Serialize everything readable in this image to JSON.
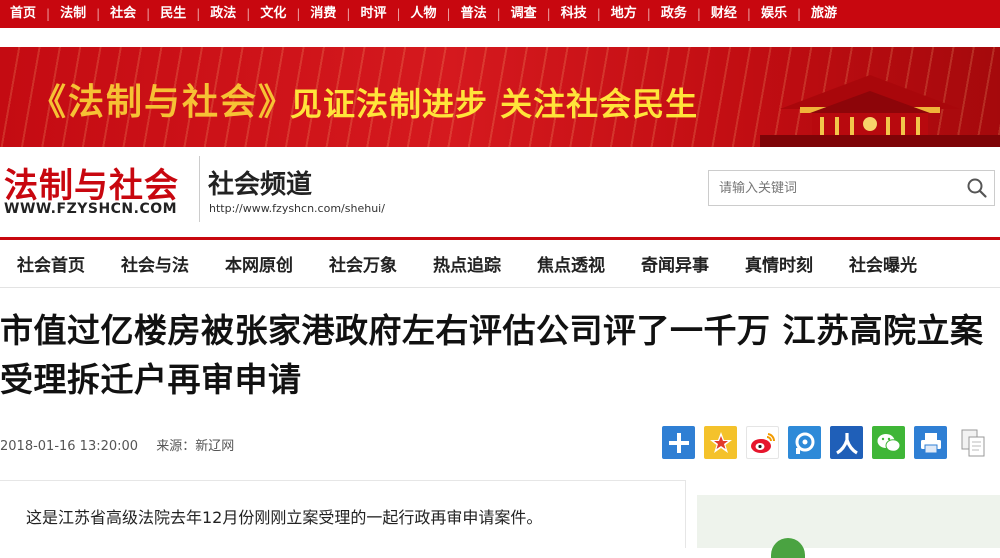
{
  "topnav": {
    "items": [
      "首页",
      "法制",
      "社会",
      "民生",
      "政法",
      "文化",
      "消费",
      "时评",
      "人物",
      "普法",
      "调查",
      "科技",
      "地方",
      "政务",
      "财经",
      "娱乐",
      "旅游"
    ],
    "separator": "|"
  },
  "banner": {
    "brand": "《法制与社会》",
    "slogan": "见证法制进步 关注社会民生"
  },
  "header": {
    "logo_title": "法制与社会",
    "logo_url": "WWW.FZYSHCN.COM",
    "channel_title": "社会频道",
    "channel_url": "http://www.fzyshcn.com/shehui/"
  },
  "search": {
    "placeholder": "请输入关键词"
  },
  "subnav": {
    "items": [
      "社会首页",
      "社会与法",
      "本网原创",
      "社会万象",
      "热点追踪",
      "焦点透视",
      "奇闻异事",
      "真情时刻",
      "社会曝光"
    ]
  },
  "article": {
    "title": "市值过亿楼房被张家港政府左右评估公司评了一千万 江苏高院立案受理拆迁户再审申请",
    "date": "2018-01-16 13:20:00",
    "source": "来源：新辽网",
    "lead": "这是江苏省高级法院去年12月份刚刚立案受理的一起行政再审申请案件。"
  },
  "share_icons": [
    "plus-share-icon",
    "qzone-icon",
    "weibo-icon",
    "tencent-weibo-icon",
    "renren-icon",
    "wechat-icon",
    "print-icon",
    "copy-icon"
  ],
  "colors": {
    "brand_red": "#c8070f",
    "banner_yellow": "#ffe43a"
  }
}
